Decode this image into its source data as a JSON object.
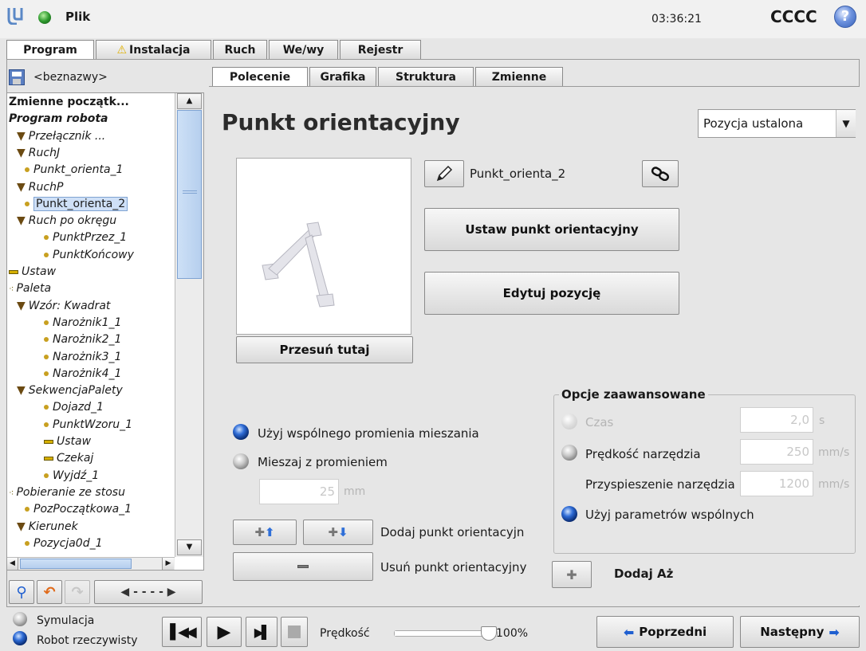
{
  "top": {
    "app_title": "Plik",
    "time": "03:36:21",
    "robot_name": "CCCC"
  },
  "main_tabs": [
    "Program",
    "Instalacja",
    "Ruch",
    "We/wy",
    "Rejestr"
  ],
  "file": {
    "name": "<beznazwy>"
  },
  "sub_tabs": [
    "Polecenie",
    "Grafika",
    "Struktura",
    "Zmienne"
  ],
  "tree": [
    {
      "label": "Zmienne początk...",
      "indent": 0,
      "icon": "none",
      "bold": true,
      "italic": false
    },
    {
      "label": "Program robota",
      "indent": 0,
      "icon": "none",
      "bold": true,
      "italic": true
    },
    {
      "label": "Przełącznik ...",
      "indent": 1,
      "icon": "triangle"
    },
    {
      "label": "RuchJ",
      "indent": 1,
      "icon": "triangle"
    },
    {
      "label": "Punkt_orienta_1",
      "indent": 2,
      "icon": "dot"
    },
    {
      "label": "RuchP",
      "indent": 1,
      "icon": "triangle"
    },
    {
      "label": "Punkt_orienta_2",
      "indent": 2,
      "icon": "dot",
      "selected": true
    },
    {
      "label": "Ruch po okręgu",
      "indent": 1,
      "icon": "triangle"
    },
    {
      "label": "PunktPrzez_1",
      "indent": 3,
      "icon": "dot"
    },
    {
      "label": "PunktKońcowy",
      "indent": 3,
      "icon": "dot"
    },
    {
      "label": "Ustaw",
      "indent": 0,
      "icon": "bar"
    },
    {
      "label": "Paleta",
      "indent": 0,
      "icon": "dots"
    },
    {
      "label": "Wzór: Kwadrat",
      "indent": 1,
      "icon": "triangle"
    },
    {
      "label": "Narożnik1_1",
      "indent": 3,
      "icon": "dot"
    },
    {
      "label": "Narożnik2_1",
      "indent": 3,
      "icon": "dot"
    },
    {
      "label": "Narożnik3_1",
      "indent": 3,
      "icon": "dot"
    },
    {
      "label": "Narożnik4_1",
      "indent": 3,
      "icon": "dot"
    },
    {
      "label": "SekwencjaPalety",
      "indent": 1,
      "icon": "triangle"
    },
    {
      "label": "Dojazd_1",
      "indent": 3,
      "icon": "dot"
    },
    {
      "label": "PunktWzoru_1",
      "indent": 3,
      "icon": "dot"
    },
    {
      "label": "Ustaw",
      "indent": 3,
      "icon": "bar"
    },
    {
      "label": "Czekaj",
      "indent": 3,
      "icon": "bar"
    },
    {
      "label": "Wyjdź_1",
      "indent": 3,
      "icon": "dot"
    },
    {
      "label": "Pobieranie ze stosu",
      "indent": 0,
      "icon": "dots"
    },
    {
      "label": "PozPoczątkowa_1",
      "indent": 2,
      "icon": "dot"
    },
    {
      "label": "Kierunek",
      "indent": 1,
      "icon": "triangle"
    },
    {
      "label": "Pozycja0d_1",
      "indent": 2,
      "icon": "dot"
    }
  ],
  "panel": {
    "title": "Punkt orientacyjny",
    "position_select": "Pozycja ustalona",
    "waypoint_name": "Punkt_orienta_2",
    "set_waypoint": "Ustaw punkt orientacyjny",
    "edit_pose": "Edytuj pozycję",
    "move_here": "Przesuń tutaj",
    "use_shared_blend": "Użyj wspólnego promienia mieszania",
    "blend_with_radius": "Mieszaj z promieniem",
    "blend_value": "25",
    "blend_unit": "mm",
    "add_waypoint": "Dodaj punkt orientacyjn",
    "remove_waypoint": "Usuń punkt orientacyjny",
    "add_until": "Dodaj Aż",
    "advanced": {
      "legend": "Opcje zaawansowane",
      "time_label": "Czas",
      "time_value": "2,0",
      "time_unit": "s",
      "speed_label": "Prędkość narzędzia",
      "speed_value": "250",
      "speed_unit": "mm/s",
      "accel_label": "Przyspieszenie narzędzia",
      "accel_value": "1200",
      "accel_unit": "mm/s",
      "shared_params": "Użyj parametrów wspólnych"
    }
  },
  "bottom": {
    "simulation": "Symulacja",
    "real_robot": "Robot rzeczywisty",
    "speed_label": "Prędkość",
    "speed_value": "100%",
    "speed_fraction": 1.0,
    "previous": "Poprzedni",
    "next": "Następny"
  },
  "colors": {
    "accent_blue": "#1f5fd0",
    "status_green": "#2e9a2e",
    "warning_yellow": "#f0c000"
  }
}
